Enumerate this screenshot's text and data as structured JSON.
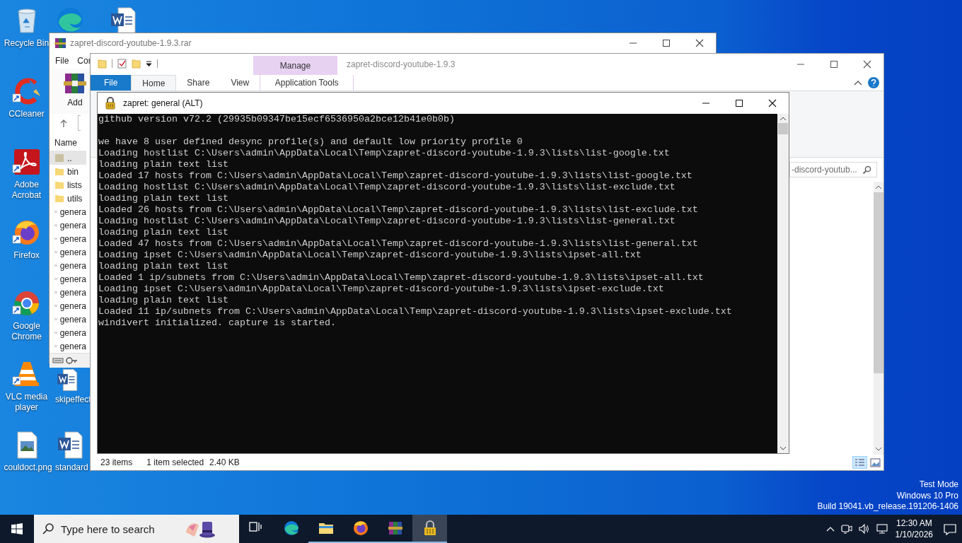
{
  "desktop_icons": [
    {
      "kind": "recycle",
      "label": "Recycle Bin",
      "shortcut": false
    },
    {
      "kind": "ccleaner",
      "label": "CCleaner",
      "shortcut": true
    },
    {
      "kind": "acrobat",
      "label": "Adobe Acrobat",
      "shortcut": true
    },
    {
      "kind": "firefox",
      "label": "Firefox",
      "shortcut": true
    },
    {
      "kind": "chrome",
      "label": "Google Chrome",
      "shortcut": true
    },
    {
      "kind": "vlc",
      "label": "VLC media player",
      "shortcut": true
    },
    {
      "kind": "image",
      "label": "couldoct.png",
      "shortcut": false
    },
    {
      "kind": "edge",
      "shortcut": false
    },
    {
      "kind": "word",
      "label": "skipeffect",
      "shortcut": false
    },
    {
      "kind": "word",
      "label": "standard",
      "shortcut": false
    },
    {
      "kind": "word",
      "shortcut": false
    }
  ],
  "winrar": {
    "title": "zapret-discord-youtube-1.9.3.rar",
    "menu": [
      "File",
      "Cor"
    ],
    "toolbar": [
      "Add"
    ],
    "column": "Name",
    "files": [
      {
        "name": "..",
        "kind": "parent",
        "selected": true
      },
      {
        "name": "bin",
        "kind": "folder",
        "selected": false
      },
      {
        "name": "lists",
        "kind": "folder",
        "selected": false
      },
      {
        "name": "utils",
        "kind": "folder",
        "selected": false
      },
      {
        "name": "genera",
        "kind": "script",
        "selected": false
      },
      {
        "name": "genera",
        "kind": "script",
        "selected": false
      },
      {
        "name": "genera",
        "kind": "script",
        "selected": false
      },
      {
        "name": "genera",
        "kind": "script",
        "selected": false
      },
      {
        "name": "genera",
        "kind": "script",
        "selected": false
      },
      {
        "name": "genera",
        "kind": "script",
        "selected": false
      },
      {
        "name": "genera",
        "kind": "script",
        "selected": false
      },
      {
        "name": "genera",
        "kind": "script",
        "selected": false
      },
      {
        "name": "genera",
        "kind": "script",
        "selected": false
      },
      {
        "name": "genera",
        "kind": "script",
        "selected": false
      },
      {
        "name": "genera",
        "kind": "script",
        "selected": false
      }
    ]
  },
  "explorer": {
    "title": "zapret-discord-youtube-1.9.3",
    "contextual_tab": "Manage",
    "tabs": [
      {
        "label": "File",
        "kind": "file",
        "selected": false
      },
      {
        "label": "Home",
        "kind": "tab",
        "selected": true
      },
      {
        "label": "Share",
        "kind": "tab",
        "selected": false
      },
      {
        "label": "View",
        "kind": "tab",
        "selected": false
      },
      {
        "label": "Application Tools",
        "kind": "contextual",
        "selected": false
      }
    ],
    "search": {
      "placeholder": "-discord-youtub..."
    },
    "status": {
      "count": "23 items",
      "selection": "1 item selected",
      "size": "2.40 KB"
    }
  },
  "console": {
    "title": "zapret: general (ALT)",
    "header": "github version v72.2 (29935b09347be15ecf6536950a2bce12b41e0b0b)",
    "lines": [
      "we have 8 user defined desync profile(s) and default low priority profile 0",
      "Loading hostlist C:\\Users\\admin\\AppData\\Local\\Temp\\zapret-discord-youtube-1.9.3\\lists\\list-google.txt",
      "loading plain text list",
      "Loaded 17 hosts from C:\\Users\\admin\\AppData\\Local\\Temp\\zapret-discord-youtube-1.9.3\\lists\\list-google.txt",
      "Loading hostlist C:\\Users\\admin\\AppData\\Local\\Temp\\zapret-discord-youtube-1.9.3\\lists\\list-exclude.txt",
      "loading plain text list",
      "Loaded 26 hosts from C:\\Users\\admin\\AppData\\Local\\Temp\\zapret-discord-youtube-1.9.3\\lists\\list-exclude.txt",
      "Loading hostlist C:\\Users\\admin\\AppData\\Local\\Temp\\zapret-discord-youtube-1.9.3\\lists\\list-general.txt",
      "loading plain text list",
      "Loaded 47 hosts from C:\\Users\\admin\\AppData\\Local\\Temp\\zapret-discord-youtube-1.9.3\\lists\\list-general.txt",
      "Loading ipset C:\\Users\\admin\\AppData\\Local\\Temp\\zapret-discord-youtube-1.9.3\\lists\\ipset-all.txt",
      "loading plain text list",
      "Loaded 1 ip/subnets from C:\\Users\\admin\\AppData\\Local\\Temp\\zapret-discord-youtube-1.9.3\\lists\\ipset-all.txt",
      "Loading ipset C:\\Users\\admin\\AppData\\Local\\Temp\\zapret-discord-youtube-1.9.3\\lists\\ipset-exclude.txt",
      "loading plain text list",
      "Loaded 11 ip/subnets from C:\\Users\\admin\\AppData\\Local\\Temp\\zapret-discord-youtube-1.9.3\\lists\\ipset-exclude.txt",
      "windivert initialized. capture is started."
    ]
  },
  "system_watermark": [
    "Test Mode",
    "Windows 10 Pro",
    "Build 19041.vb_release.191206-1406"
  ],
  "taskbar": {
    "search": {
      "placeholder": "Type here to search"
    },
    "apps": [
      {
        "kind": "taskview",
        "running": false,
        "selected": false
      },
      {
        "kind": "edge",
        "running": false,
        "selected": false
      },
      {
        "kind": "explorer",
        "running": true,
        "selected": false
      },
      {
        "kind": "firefox",
        "running": true,
        "selected": false
      },
      {
        "kind": "winrar",
        "running": true,
        "selected": false
      },
      {
        "kind": "lock",
        "running": true,
        "selected": true
      }
    ],
    "clock": {
      "time": "12:30 AM",
      "date": "1/10/2026"
    }
  }
}
